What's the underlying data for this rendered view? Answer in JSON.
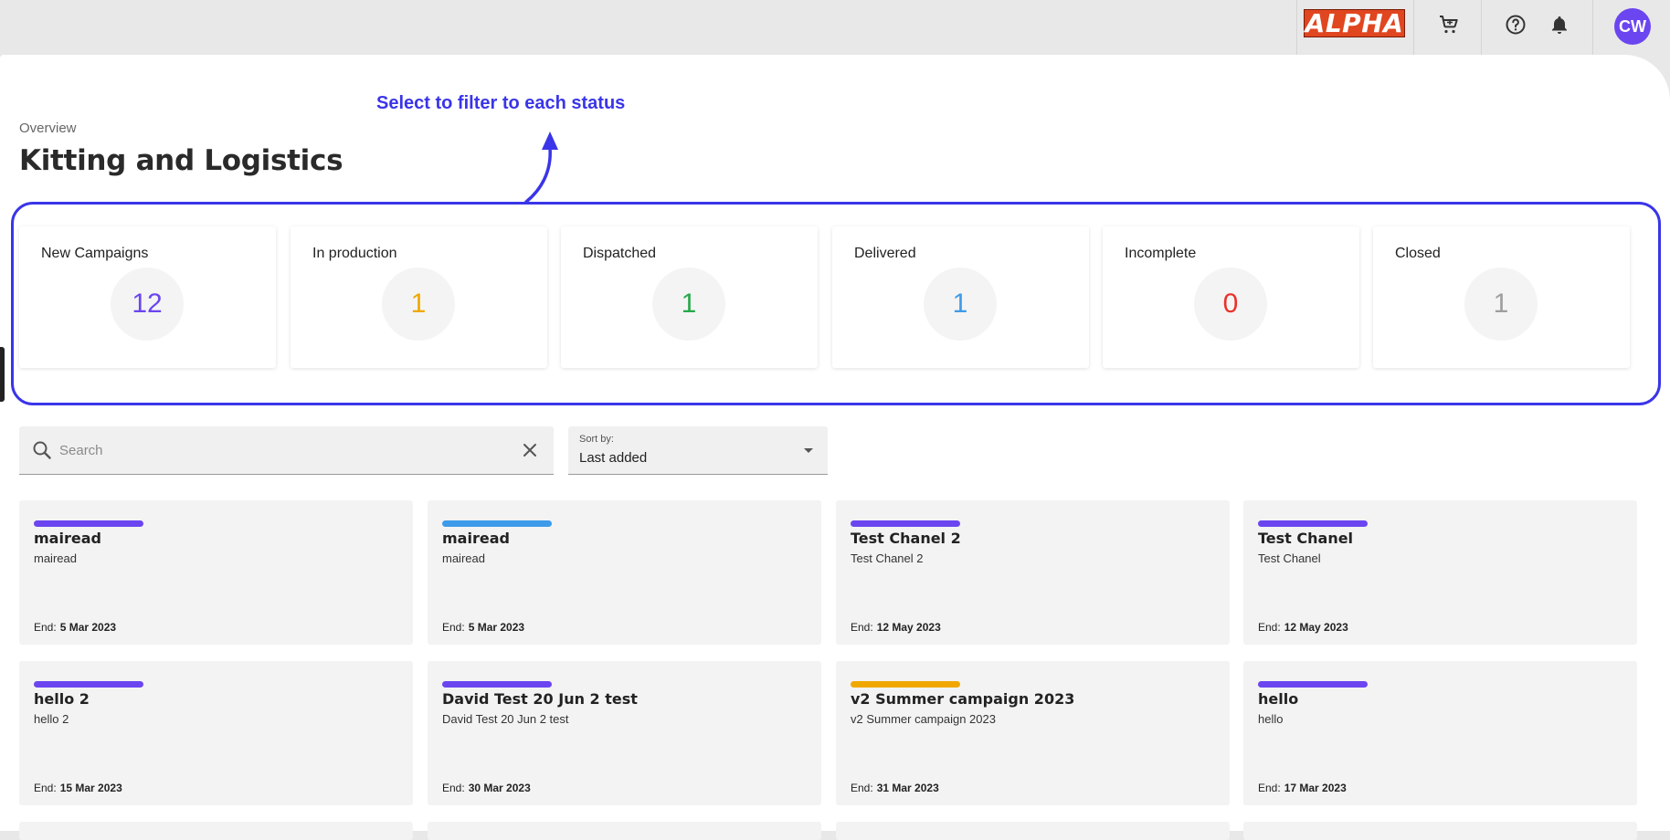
{
  "header": {
    "logo_text": "ALPHA",
    "avatar_initials": "CW",
    "icons": [
      "cart-icon",
      "help-icon",
      "bell-icon"
    ]
  },
  "page": {
    "breadcrumb": "Overview",
    "title": "Kitting and Logistics",
    "annotation": "Select to filter to each status"
  },
  "status_cards": [
    {
      "label": "New Campaigns",
      "count": "12",
      "color": "#6b45f0"
    },
    {
      "label": "In production",
      "count": "1",
      "color": "#f0a800"
    },
    {
      "label": "Dispatched",
      "count": "1",
      "color": "#27a84a"
    },
    {
      "label": "Delivered",
      "count": "1",
      "color": "#3d9be9"
    },
    {
      "label": "Incomplete",
      "count": "0",
      "color": "#e8322a"
    },
    {
      "label": "Closed",
      "count": "1",
      "color": "#9e9e9e"
    }
  ],
  "search": {
    "placeholder": "Search",
    "value": ""
  },
  "sort": {
    "label": "Sort by:",
    "value": "Last added"
  },
  "campaigns": [
    {
      "name": "mairead",
      "subtitle": "mairead",
      "end_label": "End:",
      "end_date": "5 Mar 2023",
      "bar_color": "#6b45f0"
    },
    {
      "name": "mairead",
      "subtitle": "mairead",
      "end_label": "End:",
      "end_date": "5 Mar 2023",
      "bar_color": "#3d9be9"
    },
    {
      "name": "Test Chanel 2",
      "subtitle": "Test Chanel 2",
      "end_label": "End:",
      "end_date": "12 May 2023",
      "bar_color": "#6b45f0"
    },
    {
      "name": "Test Chanel",
      "subtitle": "Test Chanel",
      "end_label": "End:",
      "end_date": "12 May 2023",
      "bar_color": "#6b45f0"
    },
    {
      "name": "hello 2",
      "subtitle": "hello 2",
      "end_label": "End:",
      "end_date": "15 Mar 2023",
      "bar_color": "#6b45f0"
    },
    {
      "name": "David Test 20 Jun 2 test",
      "subtitle": "David Test 20 Jun 2 test",
      "end_label": "End:",
      "end_date": "30 Mar 2023",
      "bar_color": "#6b45f0"
    },
    {
      "name": "v2 Summer campaign 2023",
      "subtitle": "v2 Summer campaign 2023",
      "end_label": "End:",
      "end_date": "31 Mar 2023",
      "bar_color": "#f0a800"
    },
    {
      "name": "hello",
      "subtitle": "hello",
      "end_label": "End:",
      "end_date": "17 Mar 2023",
      "bar_color": "#6b45f0"
    }
  ]
}
